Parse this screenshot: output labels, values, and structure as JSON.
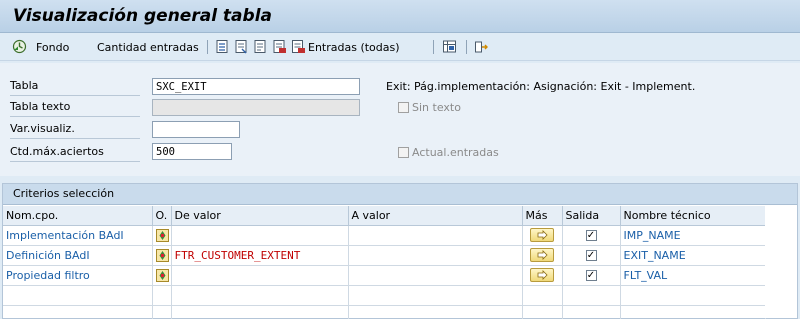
{
  "window": {
    "title": "Visualización general tabla"
  },
  "toolbar": {
    "fondo_label": "Fondo",
    "cantidad_label": "Cantidad entradas",
    "entradas_todas_label": "Entradas (todas)"
  },
  "form": {
    "tabla_label": "Tabla",
    "tabla_value": "SXC_EXIT",
    "tabla_desc": "Exit: Pág.implementación: Asignación: Exit - Implement.",
    "tabla_texto_label": "Tabla texto",
    "tabla_texto_value": "",
    "sin_texto_label": "Sin texto",
    "var_label": "Var.visualiz.",
    "var_value": "",
    "ctd_label": "Ctd.máx.aciertos",
    "ctd_value": "500",
    "actual_label": "Actual.entradas"
  },
  "criteria": {
    "caption": "Criterios selección",
    "columns": [
      "Nom.cpo.",
      "O.",
      "De valor",
      "A valor",
      "Más",
      "Salida",
      "Nombre técnico"
    ],
    "rows": [
      {
        "field": "Implementación BAdI",
        "from": "",
        "to": "",
        "output": true,
        "tech": "IMP_NAME"
      },
      {
        "field": "Definición BAdI",
        "from": "FTR_CUSTOMER_EXTENT",
        "to": "",
        "output": true,
        "tech": "EXIT_NAME"
      },
      {
        "field": "Propiedad filtro",
        "from": "",
        "to": "",
        "output": true,
        "tech": "FLT_VAL"
      }
    ]
  },
  "colors": {
    "accent": "#1a5fa8",
    "value_red": "#c00000",
    "background": "#dfebf5"
  }
}
